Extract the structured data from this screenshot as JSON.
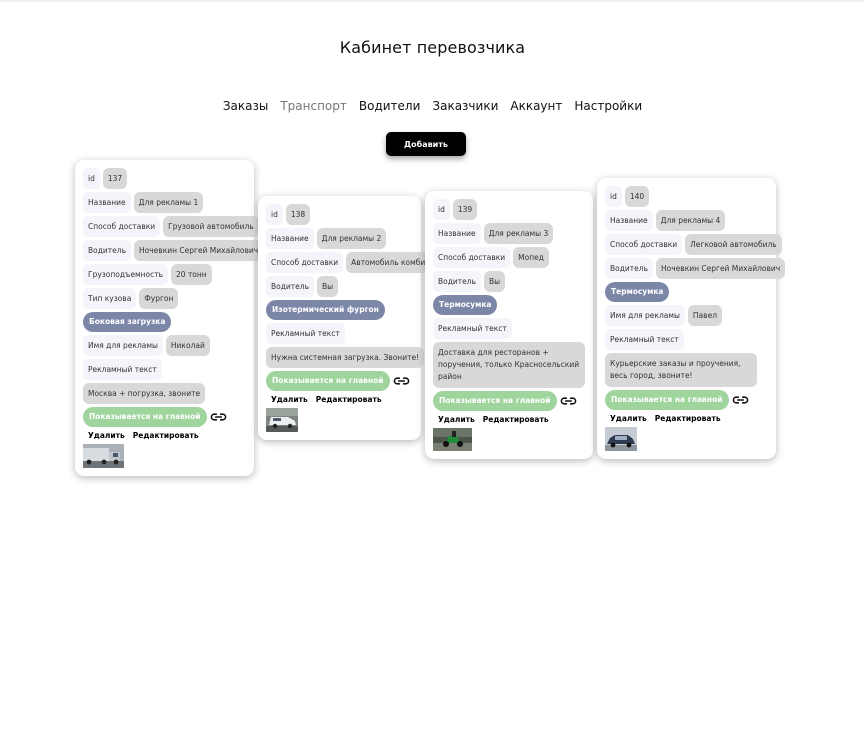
{
  "page": {
    "title": "Кабинет перевозчика"
  },
  "nav": [
    {
      "label": "Заказы",
      "active": false
    },
    {
      "label": "Транспорт",
      "active": true
    },
    {
      "label": "Водители",
      "active": false
    },
    {
      "label": "Заказчики",
      "active": false
    },
    {
      "label": "Аккаунт",
      "active": false
    },
    {
      "label": "Настройки",
      "active": false
    }
  ],
  "add_button": "Добавить",
  "labels": {
    "id": "id",
    "name": "Название",
    "delivery": "Способ доставки",
    "driver": "Водитель",
    "capacity": "Грузоподъемность",
    "body_type": "Тип кузова",
    "ad_name": "Имя для рекламы",
    "ad_text": "Рекламный текст",
    "shown_on_main": "Показывается на главной",
    "delete": "Удалить",
    "edit": "Редактировать"
  },
  "cards": [
    {
      "id": "137",
      "name": "Для рекламы 1",
      "delivery": "Грузовой автомобиль",
      "driver": "Ночевкин Сергей Михайлович",
      "capacity": "20 тонн",
      "body_type": "Фургон",
      "tag": "Боковая загрузка",
      "ad_name": "Николай",
      "ad_text": "Москва + погрузка, звоните",
      "image": "truck"
    },
    {
      "id": "138",
      "name": "Для рекламы 2",
      "delivery": "Автомобиль комби",
      "driver": "Вы",
      "tag": "Изотермический фургон",
      "ad_text": "Нужна системная загрузка. Звоните!",
      "image": "van"
    },
    {
      "id": "139",
      "name": "Для рекламы 3",
      "delivery": "Мопед",
      "driver": "Вы",
      "tag": "Термосумка",
      "ad_text": "Доставка для ресторанов + поручения, только Красносельский район",
      "image": "moped"
    },
    {
      "id": "140",
      "name": "Для рекламы 4",
      "delivery": "Легковой автомобиль",
      "driver": "Ночевкин Сергей Михайлович",
      "tag": "Термосумка",
      "ad_name": "Павел",
      "ad_text": "Курьерские заказы и проучения, весь город, звоните!",
      "image": "car"
    }
  ],
  "colors": {
    "tag_blue": "#7c87a8",
    "shown_green": "#9fd49d",
    "value_gray": "#d8d8d8",
    "label_bg": "#f4f5fa"
  },
  "icons": {
    "link": "link-icon"
  }
}
